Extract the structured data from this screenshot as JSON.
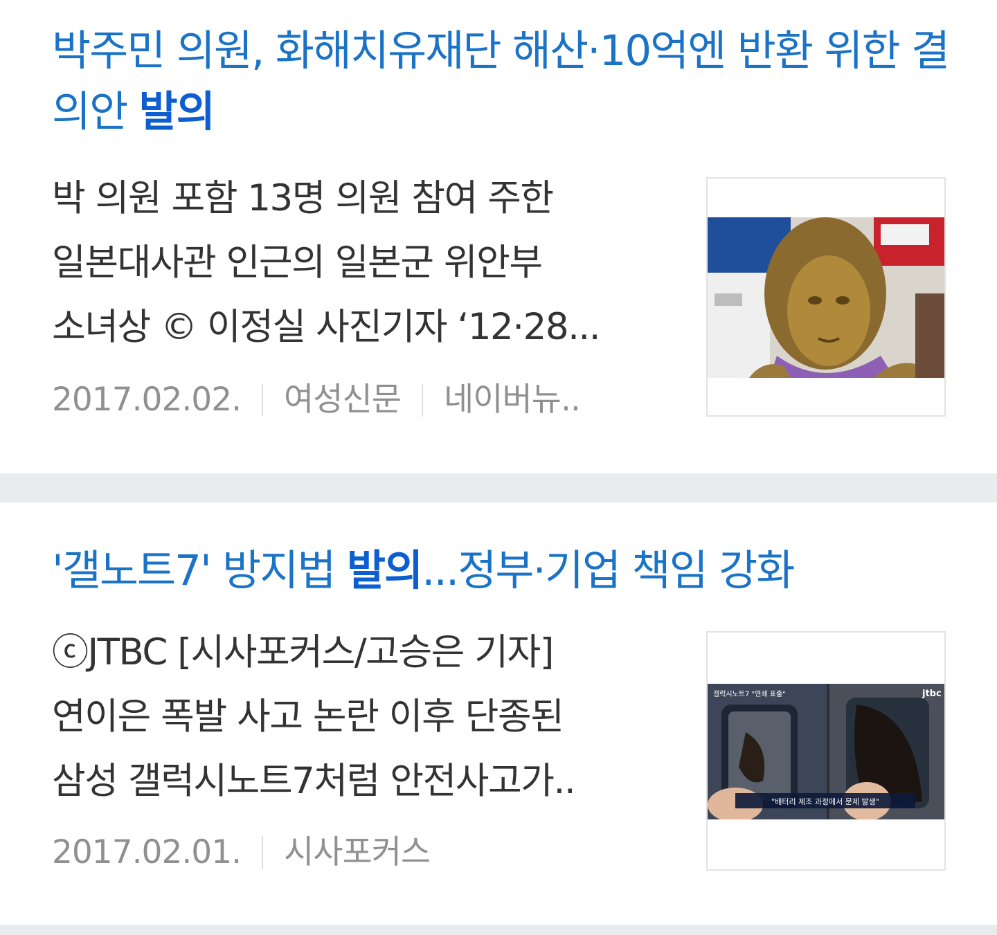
{
  "articles": [
    {
      "title_before": "박주민 의원, 화해치유재단 해산·10억엔 반환 위한 결의안 ",
      "title_highlight": "발의",
      "title_after": "",
      "snippet_lines": [
        "박 의원 포함 13명 의원 참여 주한",
        "일본대사관 인근의 일본군 위안부",
        "소녀상 © 이정실 사진기자 ‘12·28..."
      ],
      "date": "2017.02.02.",
      "source": "여성신문",
      "via": "네이버뉴..",
      "thumbnail_icon": "statue-photo-thumbnail"
    },
    {
      "title_before": "'갤노트7' 방지법 ",
      "title_highlight": "발의",
      "title_after": "...정부·기업 책임 강화",
      "snippet_lines": [
        "ⓒJTBC [시사포커스/고승은 기자]",
        "연이은 폭발 사고 논란 이후 단종된",
        "삼성 갤럭시노트7처럼 안전사고가.."
      ],
      "date": "2017.02.01.",
      "source": "시사포커스",
      "thumbnail_icon": "burnt-phone-news-thumbnail",
      "thumbnail_caption": "\"배터리 제조 과정에서 문제 발생\"",
      "thumbnail_logo": "jtbc"
    }
  ],
  "colors": {
    "title": "#1a73c7",
    "highlight": "#0d5fd0",
    "snippet": "#333333",
    "meta": "#909090",
    "divider": "#e9ecef"
  }
}
